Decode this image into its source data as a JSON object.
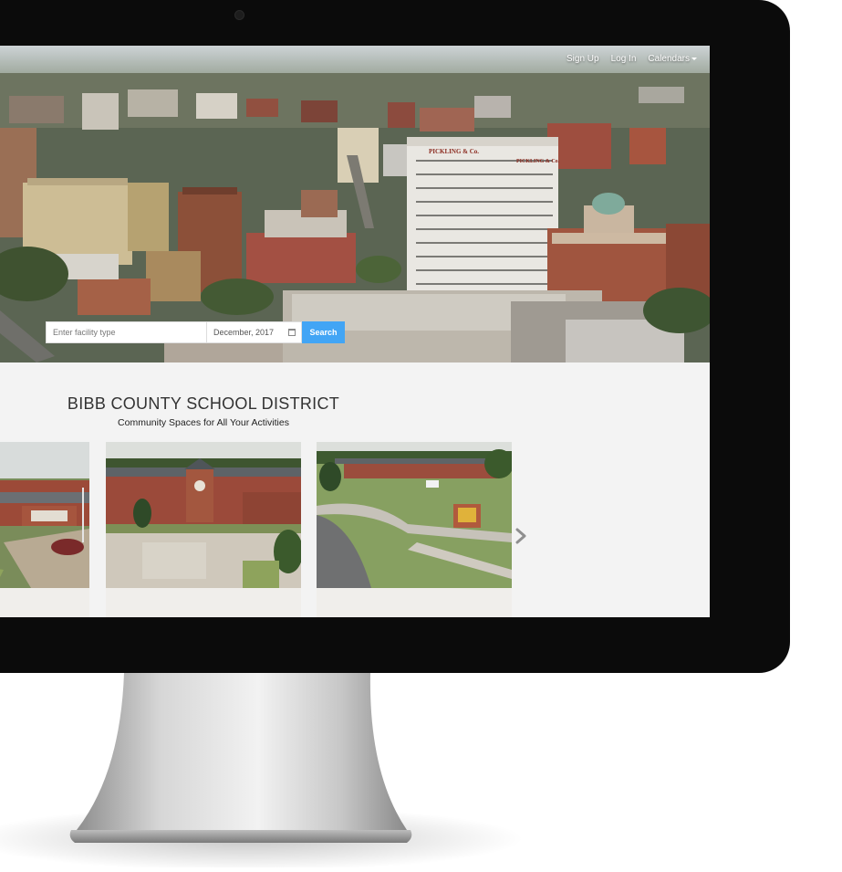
{
  "nav": {
    "signup": "Sign Up",
    "login": "Log In",
    "calendars": "Calendars"
  },
  "search": {
    "facility_placeholder": "Enter facility type",
    "date_value": "December, 2017",
    "button_label": "Search"
  },
  "hero": {
    "sign_left": "PICKLING & Co.",
    "sign_right": "PICKLING & Co."
  },
  "main": {
    "title": "BIBB COUNTY SCHOOL DISTRICT",
    "subtitle": "Community Spaces for All Your Activities"
  },
  "icons": {
    "calendar": "calendar-icon",
    "next": "chevron-right-icon",
    "caret": "caret-down-icon"
  },
  "colors": {
    "accent": "#42a5f5",
    "bezel": "#0b0b0b",
    "page_bg": "#f3f3f3"
  }
}
